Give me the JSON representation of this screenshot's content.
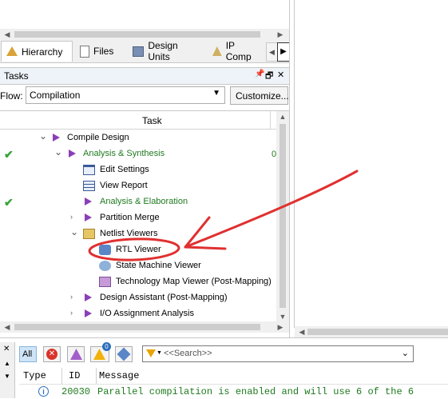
{
  "tabs": [
    {
      "label": "Hierarchy",
      "icon": "hierarchy-icon",
      "active": true
    },
    {
      "label": "Files",
      "icon": "files-icon"
    },
    {
      "label": "Design Units",
      "icon": "design-units-icon"
    },
    {
      "label": "IP Comp",
      "icon": "ip-components-icon"
    }
  ],
  "tasks_panel": {
    "title": "Tasks",
    "pin_glyph": "📌",
    "float_glyph": "🗗",
    "close_glyph": "✕"
  },
  "flow": {
    "label": "Flow:",
    "value": "Compilation",
    "customize_label": "Customize..."
  },
  "task_table": {
    "column_header": "Task",
    "extra_column_fragment": "0"
  },
  "tasks": [
    {
      "label": "Compile Design",
      "checked": false,
      "expander": "⌄",
      "icon": "play-icon",
      "green": false
    },
    {
      "label": "Analysis & Synthesis",
      "checked": true,
      "expander": "⌄",
      "icon": "play-icon",
      "green": true
    },
    {
      "label": "Edit Settings",
      "checked": false,
      "expander": "",
      "icon": "settings-window-icon",
      "green": false
    },
    {
      "label": "View Report",
      "checked": false,
      "expander": "",
      "icon": "report-table-icon",
      "green": false
    },
    {
      "label": "Analysis & Elaboration",
      "checked": true,
      "expander": "",
      "icon": "play-icon",
      "green": true
    },
    {
      "label": "Partition Merge",
      "checked": false,
      "expander": "›",
      "icon": "play-icon",
      "green": false
    },
    {
      "label": "Netlist Viewers",
      "checked": false,
      "expander": "⌄",
      "icon": "folder-open-icon",
      "green": false
    },
    {
      "label": "RTL Viewer",
      "checked": false,
      "expander": "",
      "icon": "rtl-viewer-icon",
      "green": false
    },
    {
      "label": "State Machine Viewer",
      "checked": false,
      "expander": "",
      "icon": "state-machine-icon",
      "green": false
    },
    {
      "label": "Technology Map Viewer (Post-Mapping)",
      "checked": false,
      "expander": "",
      "icon": "tech-map-icon",
      "green": false
    },
    {
      "label": "Design Assistant (Post-Mapping)",
      "checked": false,
      "expander": "›",
      "icon": "play-icon",
      "green": false
    },
    {
      "label": "I/O Assignment Analysis",
      "checked": false,
      "expander": "›",
      "icon": "play-icon",
      "green": false
    }
  ],
  "checkmark_glyph": "✔",
  "messages": {
    "filter_all": "All",
    "filter_badge": "0",
    "search_placeholder": "<<Search>>",
    "columns": {
      "type": "Type",
      "id": "ID",
      "message": "Message"
    },
    "rows": [
      {
        "type_icon": "info-icon",
        "id": "20030",
        "text": "Parallel compilation is enabled and will use 6 of the 6"
      }
    ]
  },
  "colors": {
    "annotation": "#e03030",
    "play": "#8b3fb7",
    "green_text": "#1f7a1f"
  }
}
